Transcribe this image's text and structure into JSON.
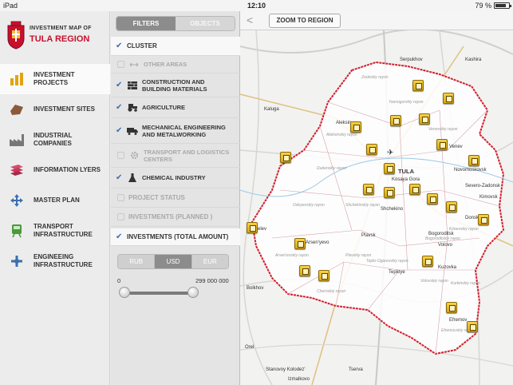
{
  "status_bar": {
    "device": "iPad",
    "time": "12:10",
    "battery": "79 %",
    "battery_level": 0.79
  },
  "app": {
    "title_line1": "INVESTMENT MAP OF",
    "title_line2": "TULA REGION",
    "brand_color": "#c8102e"
  },
  "nav": [
    {
      "label": "INVESTMENT\nPROJECTS",
      "icon": "bar-chart-icon",
      "active": true
    },
    {
      "label": "INVESTMENT SITES",
      "icon": "land-plot-icon",
      "active": false
    },
    {
      "label": "INDUSTRIAL\nCOMPANIES",
      "icon": "factory-icon",
      "active": false
    },
    {
      "label": "INFORMATION LYERS",
      "icon": "layers-icon",
      "active": false
    },
    {
      "label": "MASTER PLAN",
      "icon": "arrows-icon",
      "active": false
    },
    {
      "label": "TRANSPORT\nINFRASTRUCTURE",
      "icon": "train-icon",
      "active": false
    },
    {
      "label": "ENGINEEING\nINFRASTRUCTURE",
      "icon": "network-icon",
      "active": false
    }
  ],
  "filters": {
    "tabs": [
      "FILTERS",
      "OBJECTS"
    ],
    "cluster_label": "CLUSTER",
    "clusters": [
      {
        "label": "OTHER AREAS",
        "checked": false,
        "icon": "double-arrow-icon"
      },
      {
        "label": "CONSTRUCTION AND\nBUILDING MATERIALS",
        "checked": true,
        "icon": "bricks-icon"
      },
      {
        "label": "AGRICULTURE",
        "checked": true,
        "icon": "tractor-icon"
      },
      {
        "label": "MECHANICAL ENGINEERING\nAND METALWORKING",
        "checked": true,
        "icon": "truck-icon"
      },
      {
        "label": "TRANSPORT AND LOGISTICS\nCENTERS",
        "checked": false,
        "icon": "gear-icon"
      },
      {
        "label": "CHEMICAL INDUSTRY",
        "checked": true,
        "icon": "flask-icon"
      }
    ],
    "project_status": "PROJECT STATUS",
    "investments_planned": "INVESTMENTS (PLANNED )",
    "investments_total": "INVESTMENTS (TOTAL AMOUNT)",
    "currencies": [
      "RUB",
      "USD",
      "EUR"
    ],
    "active_currency": "USD",
    "range_min": "0",
    "range_max": "299 000 000"
  },
  "map": {
    "back_label": "<",
    "zoom_button": "ZOOM TO REGION",
    "towns": [
      "Serpukhov",
      "Kashira",
      "Aleksin",
      "Kaluga",
      "Venev",
      "TULA",
      "Novomoskovsk",
      "Severo-Zadonsk",
      "Kimovsk",
      "Shchekino",
      "Bogoroditsk",
      "Belev",
      "Arsen'yevo",
      "Plavsk",
      "Teploye",
      "Kuzovka",
      "Volovo",
      "Bolkhov",
      "Orel",
      "Stanovoy Kolodez'",
      "Izmalkovo",
      "Tserva",
      "Efremov",
      "Kosaya Gora",
      "Donskoy"
    ],
    "rayons": [
      "Zaokskiy rayon",
      "Yasnogorskiy rayon",
      "Aleksinskiy rayon",
      "Venevskiy rayon",
      "Dubenskiy rayon",
      "Odoyevskiy rayon",
      "Shchekinskiy rayon",
      "Arsen'evskiy rayon",
      "Plavskiy rayon",
      "Teplo-Ogarevskiy rayon",
      "Volovskiy rayon",
      "Kurkinskiy rayon",
      "Bogoroditskiy rayon",
      "Kireevskiy rayon",
      "Chernskiy rayon",
      "Efremovskiy rayon"
    ]
  }
}
